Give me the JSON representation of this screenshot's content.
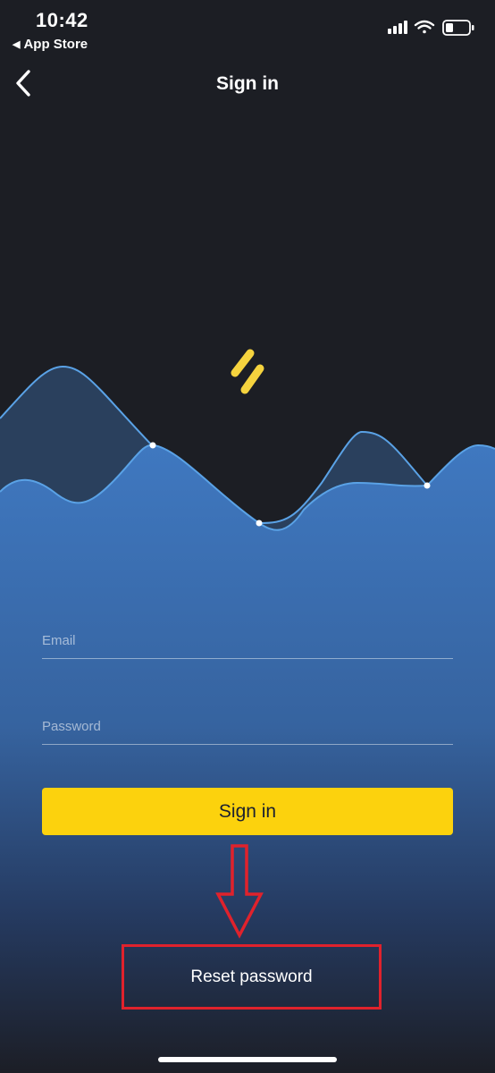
{
  "status_bar": {
    "time": "10:42",
    "back_app_label": "App Store"
  },
  "nav": {
    "title": "Sign in",
    "back_icon": "chevron-left-icon"
  },
  "logo": {
    "icon": "app-logo-icon",
    "color": "#f5d33e"
  },
  "form": {
    "email_placeholder": "Email",
    "email_value": "",
    "password_placeholder": "Password",
    "password_value": "",
    "sign_in_label": "Sign in",
    "reset_password_label": "Reset password"
  },
  "colors": {
    "background": "#1c1e24",
    "accent": "#fcd20d",
    "wave_blue": "#3a72b8",
    "wave_line": "#5aa2e6",
    "annotation_red": "#e0222c"
  },
  "annotations": {
    "arrow_icon": "down-arrow-outline-icon",
    "highlight": "red-highlight-box"
  }
}
